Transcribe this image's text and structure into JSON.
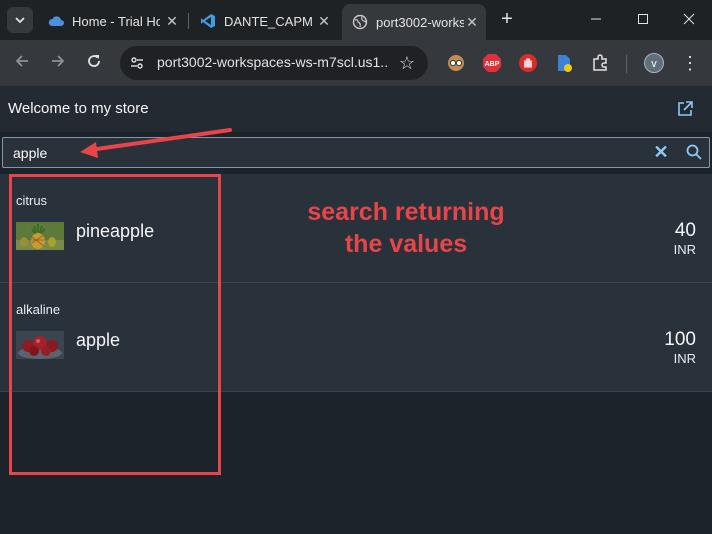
{
  "browser": {
    "tabs": [
      {
        "title": "Home - Trial Ho",
        "icon": "cloud-icon"
      },
      {
        "title": "DANTE_CAPM_",
        "icon": "vscode-icon"
      },
      {
        "title": "port3002-works",
        "icon": "globe-icon",
        "active": true
      }
    ],
    "address": "port3002-workspaces-ws-m7scl.us1...",
    "profile_initial": "v",
    "extensions": [
      "reader-icon",
      "adblock-icon",
      "stop-hand-icon",
      "file-icon",
      "puzzle-icon"
    ],
    "adblock_label": "ABP"
  },
  "app": {
    "title": "Welcome to my store",
    "search": {
      "value": "apple"
    },
    "products": [
      {
        "category": "citrus",
        "name": "pineapple",
        "price": "40",
        "currency": "INR"
      },
      {
        "category": "alkaline",
        "name": "apple",
        "price": "100",
        "currency": "INR"
      }
    ]
  },
  "annotation": {
    "line1": "search returning",
    "line2": "the values",
    "color": "#e8454a"
  }
}
